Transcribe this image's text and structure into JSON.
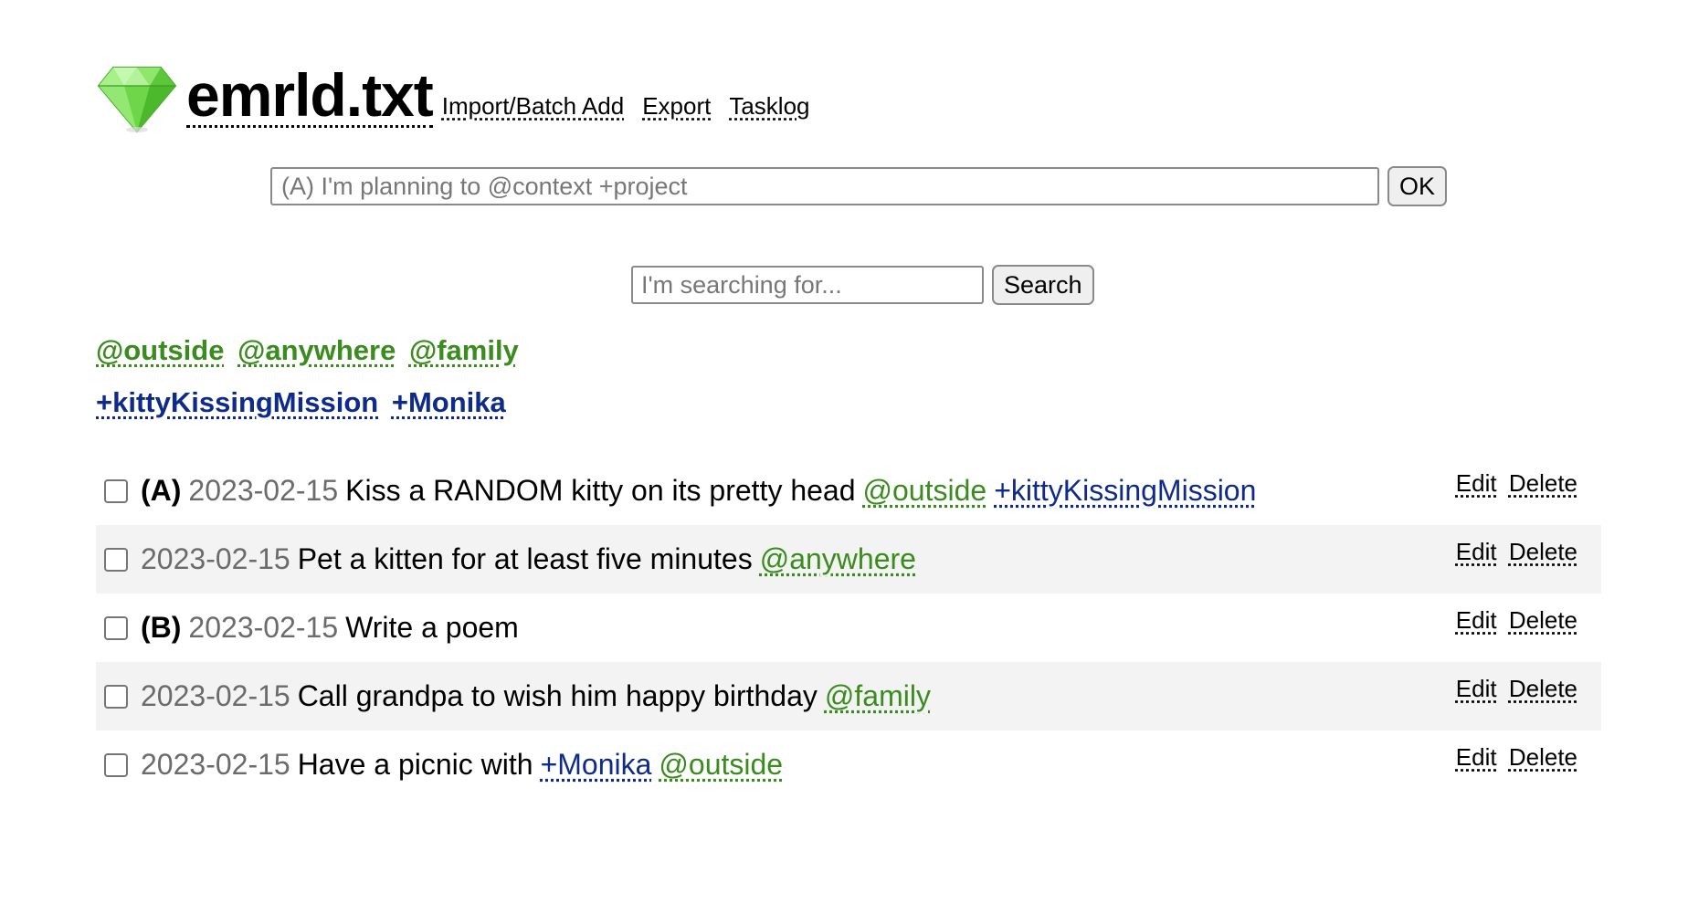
{
  "header": {
    "title": "emrld.txt",
    "logo_icon": "emerald-gem-icon",
    "nav": [
      "Import/Batch Add",
      "Export",
      "Tasklog"
    ]
  },
  "add_task": {
    "placeholder": "(A) I'm planning to @context +project",
    "button": "OK"
  },
  "search": {
    "placeholder": "I'm searching for...",
    "button": "Search"
  },
  "contexts": [
    "@outside",
    "@anywhere",
    "@family"
  ],
  "projects": [
    "+kittyKissingMission",
    "+Monika"
  ],
  "colors": {
    "context": "#3a8c1e",
    "project": "#0d2a8c",
    "date": "#6b6b6b",
    "row_alt": "#f3f3f3"
  },
  "tasks": [
    {
      "priority": "(A)",
      "date": "2023-02-15",
      "text": "Kiss a RANDOM kitty on its pretty head",
      "tag1": "@outside",
      "tag2": "+kittyKissingMission"
    },
    {
      "priority": "",
      "date": "2023-02-15",
      "text": "Pet a kitten for at least five minutes",
      "tag1": "@anywhere"
    },
    {
      "priority": "(B)",
      "date": "2023-02-15",
      "text": "Write a poem"
    },
    {
      "priority": "",
      "date": "2023-02-15",
      "text": "Call grandpa to wish him happy birthday",
      "tag1": "@family"
    },
    {
      "priority": "",
      "date": "2023-02-15",
      "text": "Have a picnic with",
      "tag1": "+Monika",
      "tag2": "@outside"
    }
  ],
  "task_actions": {
    "edit": "Edit",
    "delete": "Delete"
  }
}
